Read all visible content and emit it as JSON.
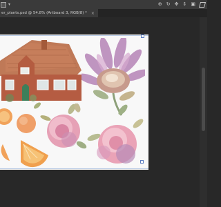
{
  "document": {
    "tab_title": "er_plants.psd @ 54.8% (Artboard 3, RGB/8) *",
    "close_glyph": "×"
  },
  "options_bar": {
    "right_icons": [
      "crosshair-icon",
      "rotate-icon",
      "pan-icon",
      "slide-icon",
      "camera-icon",
      "3d-box-icon"
    ]
  },
  "colors": {
    "app_bg": "#282828",
    "bar_bg": "#3a3a3a",
    "canvas_bg": "#f8f8f8",
    "selection": "#5d7ec2"
  }
}
